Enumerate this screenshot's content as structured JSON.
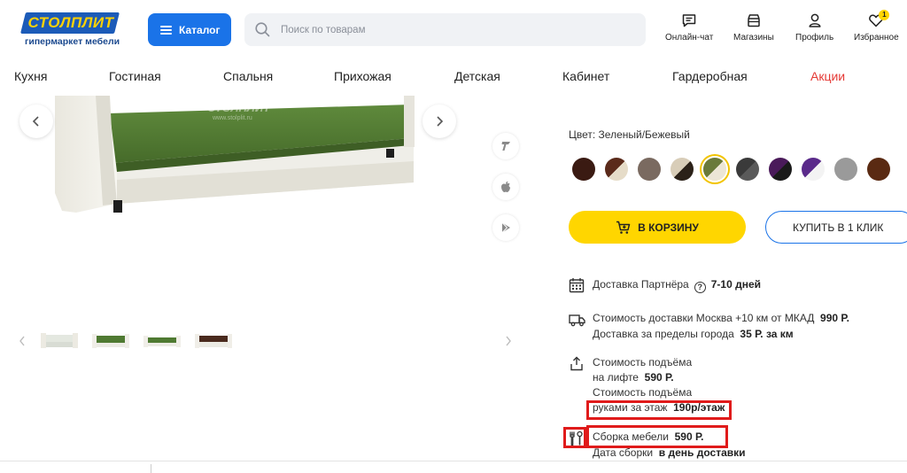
{
  "header": {
    "logo_text": "СТОЛПЛИТ",
    "logo_subtitle": "гипермаркет мебели",
    "catalog_label": "Каталог",
    "search_placeholder": "Поиск по товарам",
    "icons": [
      {
        "name": "chat-icon",
        "label": "Онлайн-чат"
      },
      {
        "name": "store-icon",
        "label": "Магазины"
      },
      {
        "name": "profile-icon",
        "label": "Профиль"
      },
      {
        "name": "heart-icon",
        "label": "Избранное",
        "badge": "1"
      }
    ]
  },
  "nav": {
    "items": [
      "Кухня",
      "Гостиная",
      "Спальня",
      "Прихожая",
      "Детская",
      "Кабинет",
      "Гардеробная",
      "Акции"
    ]
  },
  "gallery": {
    "watermark": "СТОЛПЛИТ",
    "watermark_url": "www.stolplit.ru"
  },
  "product": {
    "color_label": "Цвет: Зеленый/Бежевый",
    "swatches": [
      {
        "name": "swatch-dark-brown",
        "colors": [
          "#3a1a12",
          "#3a1a12"
        ]
      },
      {
        "name": "swatch-brown-beige",
        "colors": [
          "#5a2a1a",
          "#e6dcc8"
        ]
      },
      {
        "name": "swatch-grey-brown",
        "colors": [
          "#7a6a60",
          "#7a6a60"
        ]
      },
      {
        "name": "swatch-beige-dark",
        "colors": [
          "#d8cdb8",
          "#2b2118"
        ]
      },
      {
        "name": "swatch-green-beige",
        "colors": [
          "#6a7a3a",
          "#ece6d6"
        ],
        "selected": true
      },
      {
        "name": "swatch-dark-grey",
        "colors": [
          "#3a3a3a",
          "#5a5a5a"
        ]
      },
      {
        "name": "swatch-purple-black",
        "colors": [
          "#4a1a5a",
          "#1a1a1a"
        ]
      },
      {
        "name": "swatch-purple-white",
        "colors": [
          "#5a2a8a",
          "#f3f3f3"
        ]
      },
      {
        "name": "swatch-light-grey",
        "colors": [
          "#9a9a9a",
          "#9a9a9a"
        ]
      },
      {
        "name": "swatch-chocolate",
        "colors": [
          "#5a2a12",
          "#5a2a12"
        ]
      }
    ],
    "cart_label": "В КОРЗИНУ",
    "one_click_label": "КУПИТЬ В 1 КЛИК",
    "partner_delivery_label": "Доставка Партнёра",
    "partner_delivery_value": "7-10 дней",
    "moscow_delivery_label": "Стоимость доставки Москва +10 км от МКАД",
    "moscow_delivery_value": "990 Р.",
    "outside_delivery_label": "Доставка за пределы города",
    "outside_delivery_value": "35 Р. за км",
    "lift_line1": "Стоимость подъёма",
    "lift_line2_label": "на лифте",
    "lift_line2_value": "590 Р.",
    "manual_line1": "Стоимость подъёма",
    "manual_line2_label": "руками за этаж",
    "manual_line2_value": "190р/этаж",
    "assembly_label": "Сборка мебели",
    "assembly_value": "590 Р.",
    "assembly_date_label": "Дата сборки",
    "assembly_date_value": "в день доставки"
  },
  "colors": {
    "brand_blue": "#1a73e8",
    "accent_yellow": "#ffd600",
    "promo_red": "#e53935",
    "highlight_red": "#e01b1b"
  }
}
